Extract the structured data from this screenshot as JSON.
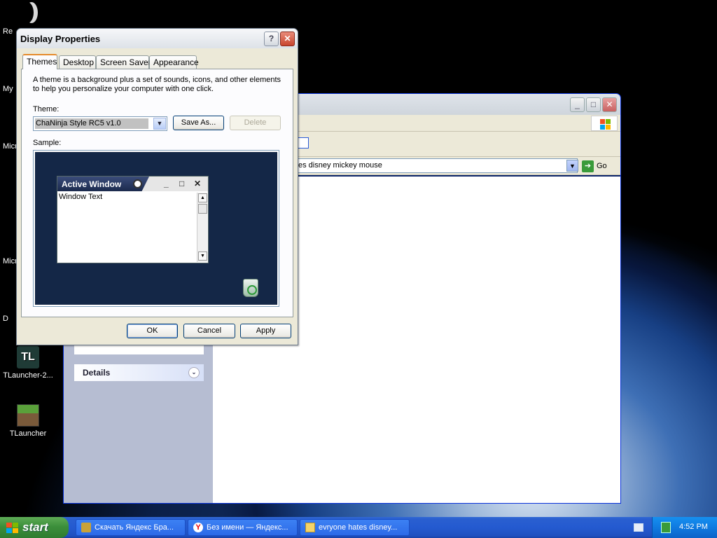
{
  "desktop": {
    "icons": [
      {
        "label": "TLauncher-2..."
      },
      {
        "label": "TLauncher"
      }
    ],
    "partial_labels": [
      "Re",
      "My",
      "Micr",
      "Micr",
      "D"
    ]
  },
  "explorer": {
    "address_value": "es disney mickey mouse",
    "go_label": "Go",
    "details_label": "Details"
  },
  "dialog": {
    "title": "Display Properties",
    "help_glyph": "?",
    "close_glyph": "✕",
    "tabs": [
      "Themes",
      "Desktop",
      "Screen Saver",
      "Appearance"
    ],
    "active_tab": "Themes",
    "description": "A theme is a background plus a set of sounds, icons, and other elements to help you personalize your computer with one click.",
    "theme_label": "Theme:",
    "theme_value": "ChaNinja Style RC5 v1.0",
    "save_as": "Save As...",
    "delete": "Delete",
    "sample_label": "Sample:",
    "sample_window_title": "Active Window",
    "sample_window_text": "Window Text",
    "ok": "OK",
    "cancel": "Cancel",
    "apply": "Apply"
  },
  "taskbar": {
    "start_label": "start",
    "items": [
      {
        "label": "Скачать Яндекс Бра...",
        "icon": "browser-icon"
      },
      {
        "label": "Без имени — Яндекс...",
        "icon": "yandex-icon"
      },
      {
        "label": "evryone hates disney...",
        "icon": "folder-icon"
      }
    ],
    "clock": "4:52 PM"
  }
}
